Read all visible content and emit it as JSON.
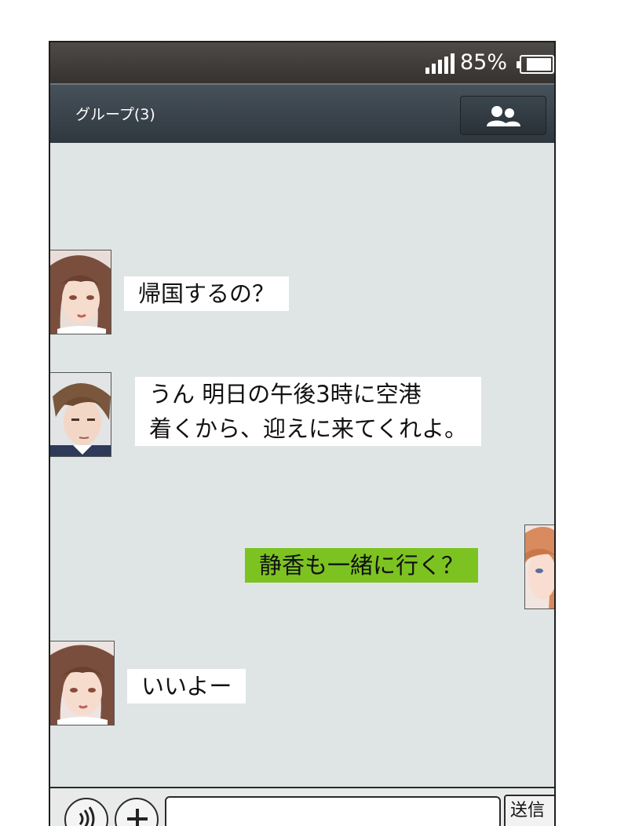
{
  "status_bar": {
    "battery_percent": "85%",
    "battery_level": 0.85
  },
  "header": {
    "title": "グループ(3)",
    "members_icon": "people-icon"
  },
  "messages": [
    {
      "side": "left",
      "lines": [
        "帰国するの？"
      ]
    },
    {
      "side": "left",
      "lines": [
        "うん 明日の午後3時に空港",
        "着くから、迎えに来てくれよ。"
      ]
    },
    {
      "side": "right",
      "lines": [
        "静香も一緒に行く？"
      ]
    },
    {
      "side": "left",
      "lines": [
        "いいよー"
      ]
    }
  ],
  "input_bar": {
    "voice_icon": "voice-icon",
    "add_icon": "plus-icon",
    "message_placeholder": "",
    "send_label": "送信"
  },
  "colors": {
    "outgoing_bubble": "#7cc321",
    "incoming_bubble": "#ffffff",
    "chat_background": "#dfe5e5"
  }
}
